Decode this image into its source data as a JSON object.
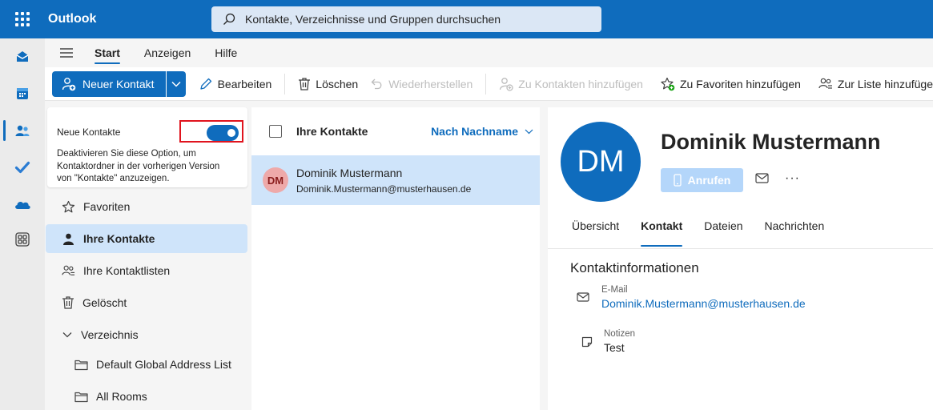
{
  "app": {
    "title": "Outlook"
  },
  "search": {
    "placeholder": "Kontakte, Verzeichnisse und Gruppen durchsuchen"
  },
  "ribbon": {
    "tabs": [
      {
        "label": "Start",
        "active": true
      },
      {
        "label": "Anzeigen",
        "active": false
      },
      {
        "label": "Hilfe",
        "active": false
      }
    ]
  },
  "commands": {
    "new_contact": "Neuer Kontakt",
    "edit": "Bearbeiten",
    "delete": "Löschen",
    "restore": "Wiederherstellen",
    "add_to_contacts": "Zu Kontakten hinzufügen",
    "add_to_favorites": "Zu Favoriten hinzufügen",
    "add_to_list": "Zur Liste hinzufüge"
  },
  "promo": {
    "title": "Neue Kontakte",
    "text": "Deaktivieren Sie diese Option, um Kontaktordner in der vorherigen Version von \"Kontakte\" anzuzeigen.",
    "toggle_on": true
  },
  "folders": {
    "favorites": "Favoriten",
    "your_contacts": "Ihre Kontakte",
    "contact_lists": "Ihre Kontaktlisten",
    "deleted": "Gelöscht",
    "directory": "Verzeichnis",
    "global_address_list": "Default Global Address List",
    "all_rooms": "All Rooms"
  },
  "contact_list": {
    "title": "Ihre Kontakte",
    "sort": "Nach Nachname",
    "items": [
      {
        "initials": "DM",
        "name": "Dominik Mustermann",
        "email": "Dominik.Mustermann@musterhausen.de"
      }
    ]
  },
  "detail": {
    "initials": "DM",
    "name": "Dominik Mustermann",
    "call": "Anrufen",
    "tabs": [
      "Übersicht",
      "Kontakt",
      "Dateien",
      "Nachrichten"
    ],
    "active_tab": "Kontakt",
    "section_title": "Kontaktinformationen",
    "email_label": "E-Mail",
    "email": "Dominik.Mustermann@musterhausen.de",
    "notes_label": "Notizen",
    "notes": "Test"
  },
  "colors": {
    "brand": "#0f6cbd",
    "selected": "#cfe4fa",
    "highlight_frame": "#e0141e"
  }
}
